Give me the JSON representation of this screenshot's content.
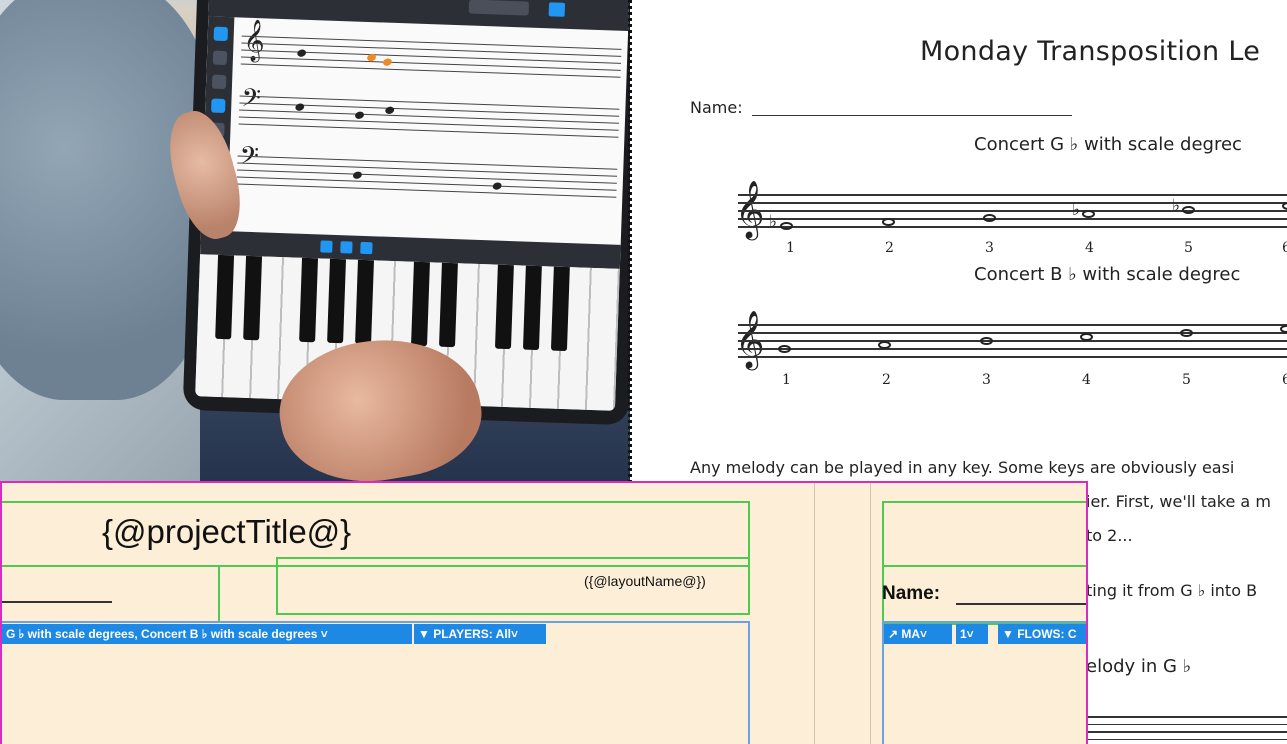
{
  "doc": {
    "title": "Monday Transposition Le",
    "name_label": "Name:",
    "heading1": "Concert G ♭  with scale degrec",
    "heading2": "Concert B ♭  with scale degrec",
    "degrees1": [
      "1",
      "2",
      "3",
      "4",
      "5",
      "6"
    ],
    "degrees2": [
      "1",
      "2",
      "3",
      "4",
      "5",
      "6"
    ],
    "para1": "Any melody can be played in any key. Some keys are obviously easi",
    "para2": "ier. First, we'll take a m",
    "para3": "to 2...",
    "para4": "ting it from G ♭  into B",
    "para5": "elody in G ♭"
  },
  "template": {
    "project_title": "{@projectTitle@}",
    "layout_name": "({@layoutName@})",
    "name_label": "Name:",
    "flows_bar_text": "G ♭  with scale degrees, Concert B ♭  with scale degrees ˅",
    "players_bar_text": "▼ PLAYERS: All˅",
    "ma_bar_text": "↗ MA˅",
    "one_bar_text": "1˅",
    "flows_bar2_text": "▼ FLOWS: C"
  },
  "colors": {
    "template_bg": "#fdeed7",
    "frame_magenta": "#d62cc4",
    "frame_green": "#4fc94f",
    "frame_blue": "#6aa3e0",
    "bar_blue": "#1e88e5",
    "accent_orange": "#f08a24"
  }
}
